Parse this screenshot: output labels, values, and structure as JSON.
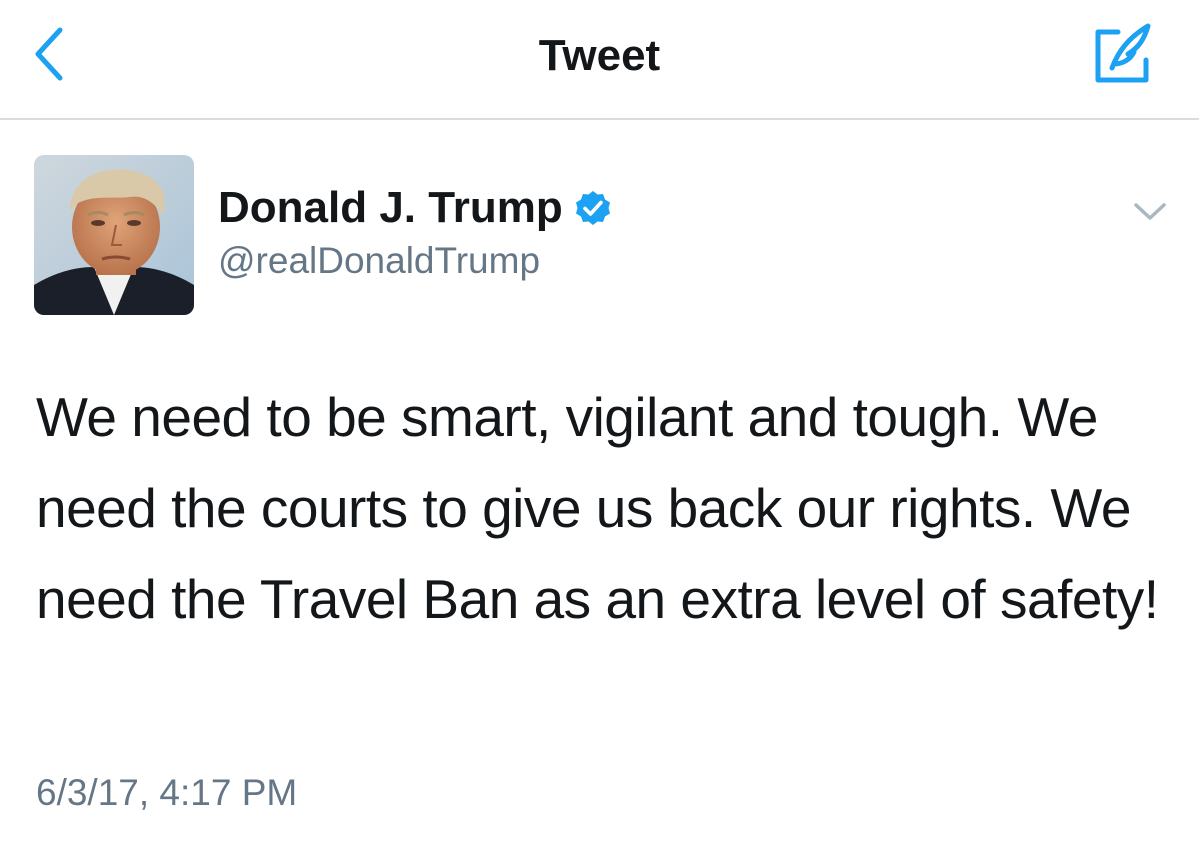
{
  "navbar": {
    "title": "Tweet",
    "back_icon": "chevron-left-icon",
    "compose_icon": "compose-tweet-icon"
  },
  "tweet": {
    "author": {
      "display_name": "Donald J. Trump",
      "handle": "@realDonaldTrump",
      "verified": true,
      "verified_icon": "verified-badge-icon",
      "avatar": "profile-photo"
    },
    "text": "We need to be smart, vigilant and tough. We need the courts to give us back our rights. We need the Travel Ban as an extra level of safety!",
    "timestamp": "6/3/17, 4:17 PM",
    "menu_icon": "chevron-down-icon"
  },
  "colors": {
    "accent": "#1da1f2",
    "text_primary": "#14171a",
    "text_secondary": "#657786",
    "divider": "#d8dde1"
  }
}
